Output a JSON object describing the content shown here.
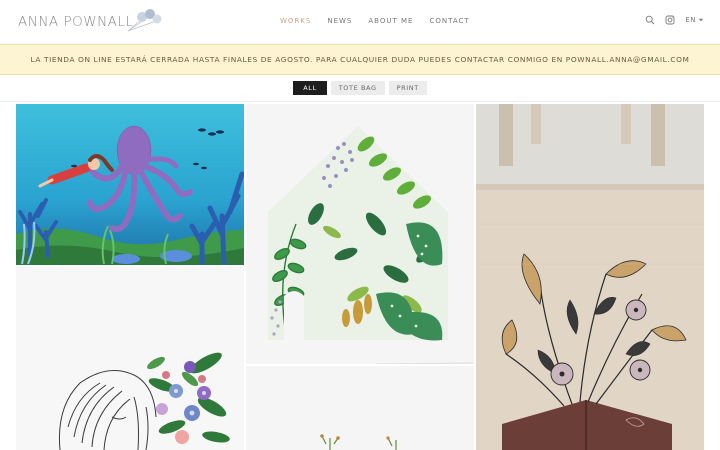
{
  "header": {
    "logo_text": "ANNA POWNALL",
    "nav": [
      {
        "label": "WORKS",
        "active": true
      },
      {
        "label": "NEWS",
        "active": false
      },
      {
        "label": "ABOUT ME",
        "active": false
      },
      {
        "label": "CONTACT",
        "active": false
      }
    ],
    "icons": [
      "search-icon",
      "instagram-icon"
    ],
    "language": "EN"
  },
  "banner": {
    "text": "LA TIENDA ON LINE ESTARÁ CERRADA HASTA FINALES DE AGOSTO. PARA CUALQUIER DUDA PUEDES CONTACTAR CONMIGO EN POWNALL.ANNA@GMAIL.COM"
  },
  "filters": [
    {
      "label": "ALL",
      "active": true
    },
    {
      "label": "TOTE BAG",
      "active": false
    },
    {
      "label": "PRINT",
      "active": false
    }
  ],
  "colors": {
    "accent": "#c7a27a",
    "banner_bg": "#fdf4d4",
    "active_filter": "#1e1e1e"
  }
}
